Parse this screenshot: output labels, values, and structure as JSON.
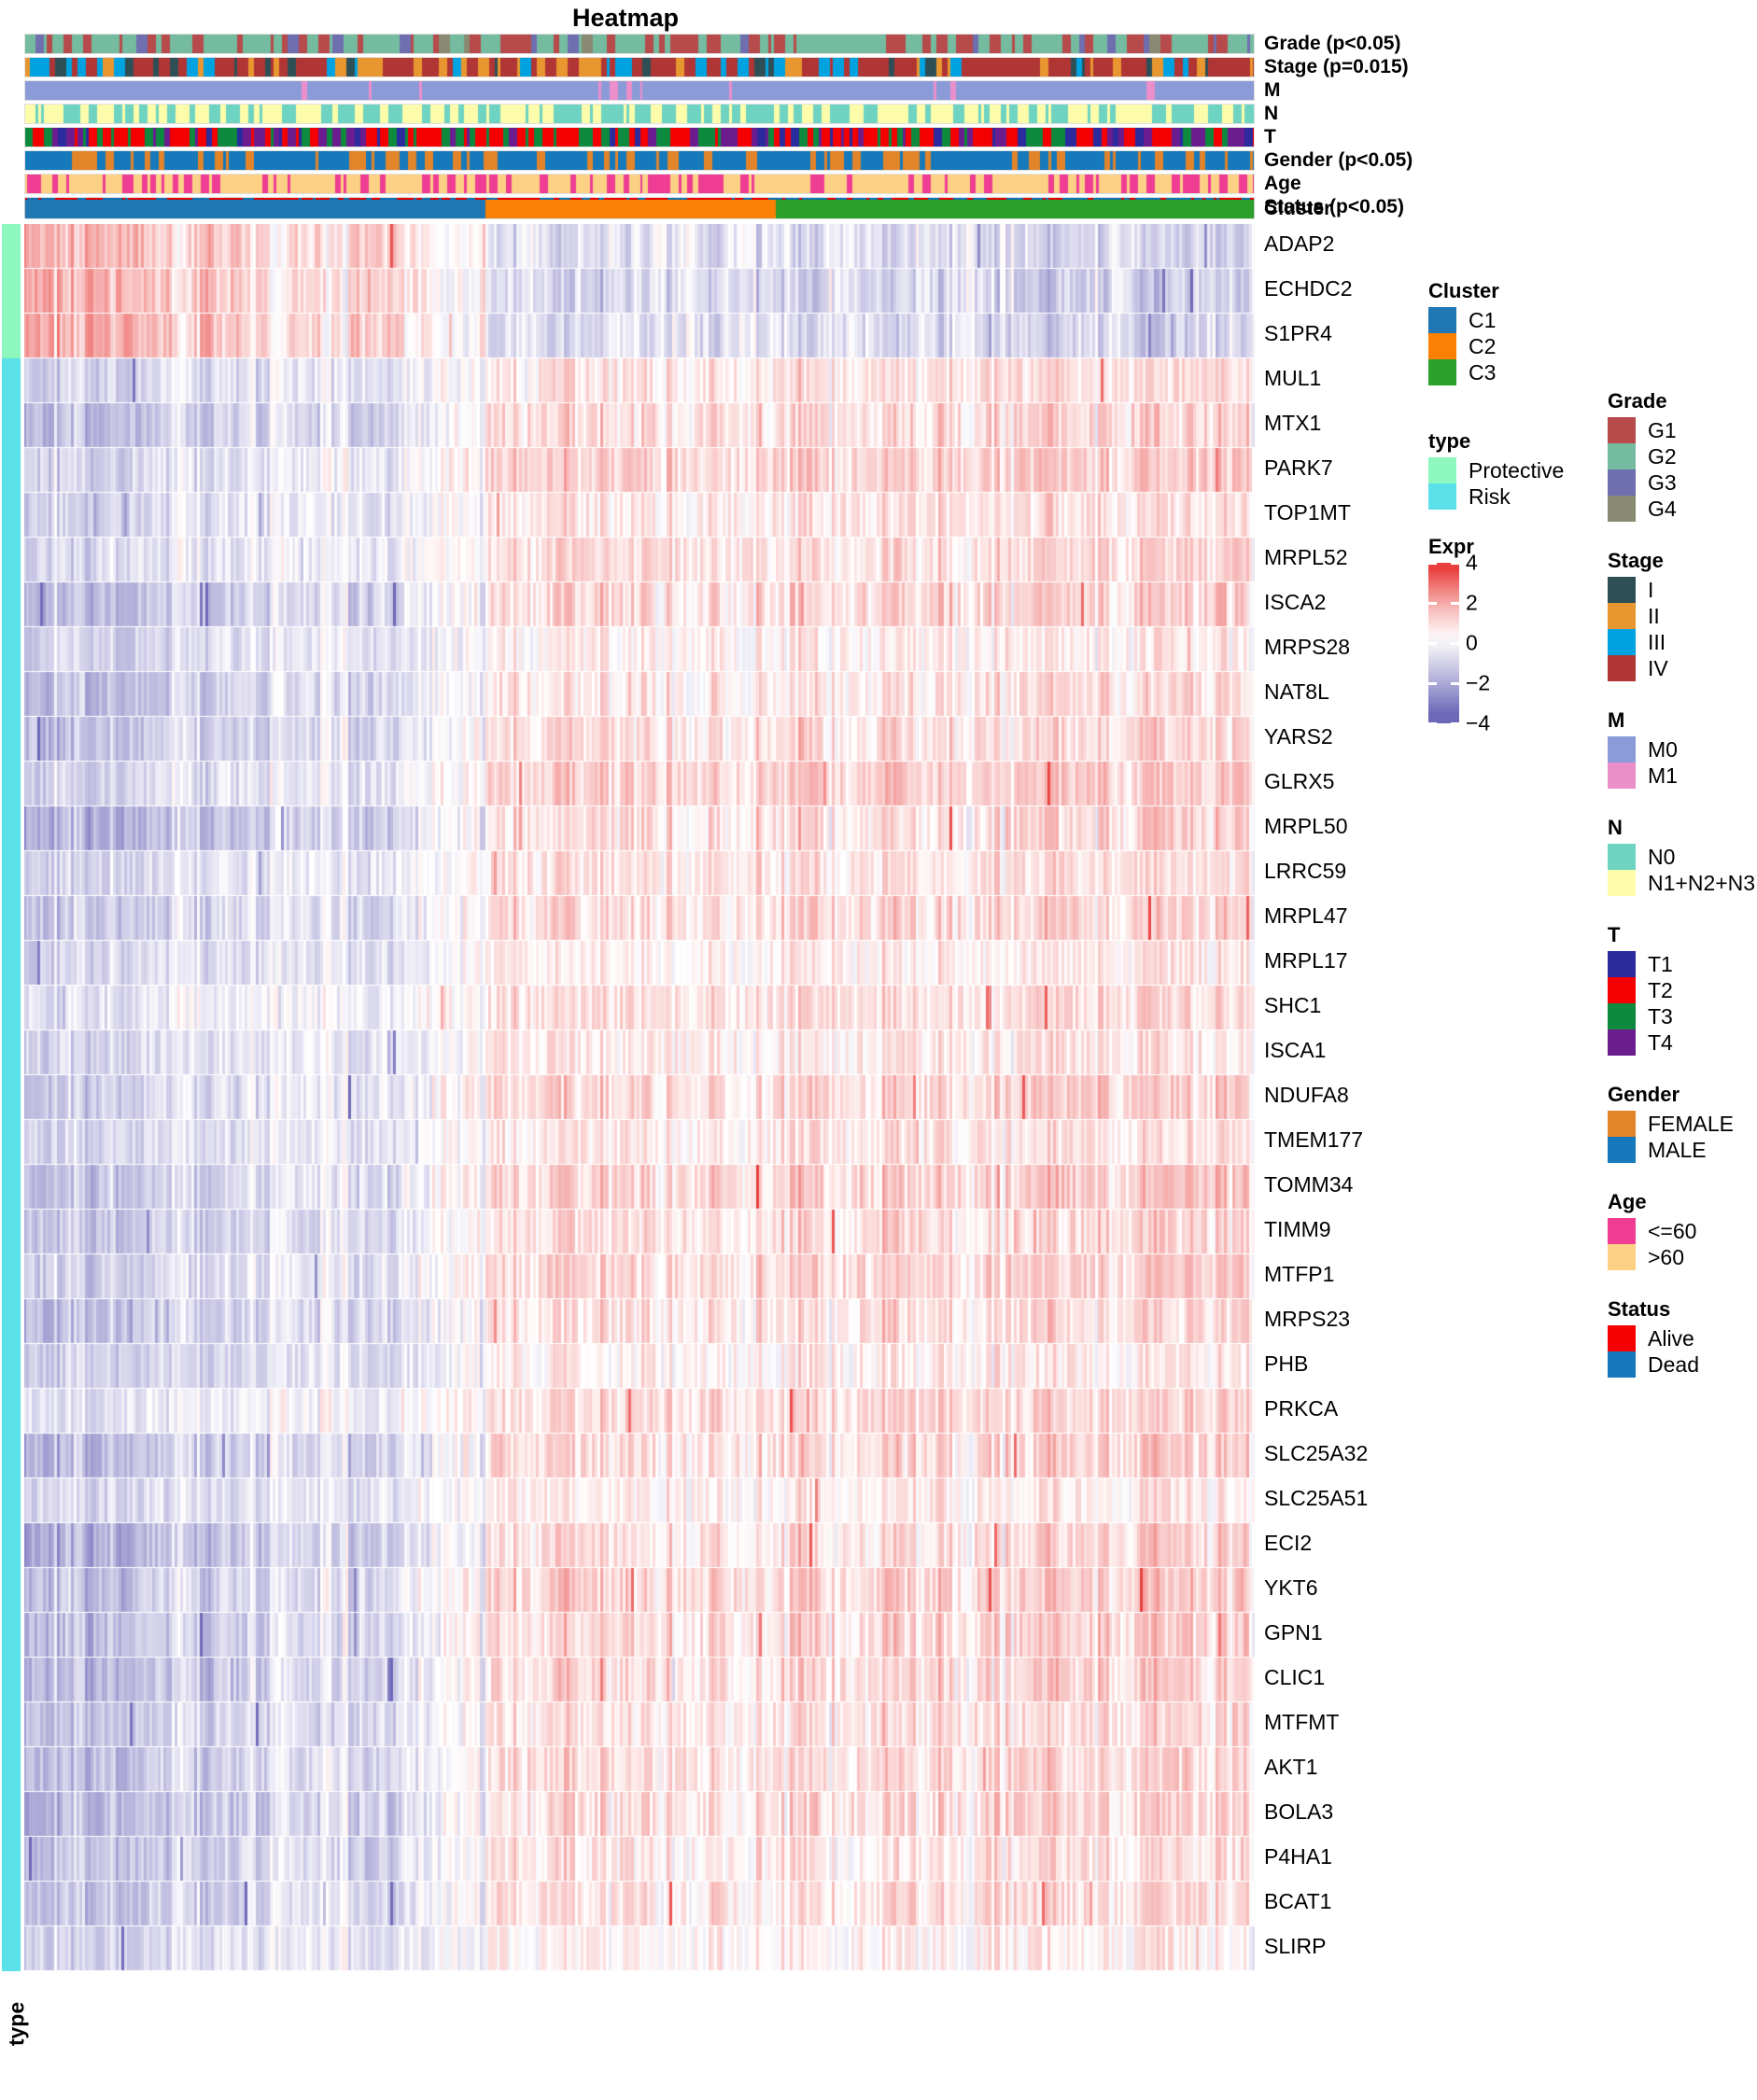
{
  "title": "Heatmap",
  "annotation_tracks": [
    {
      "id": "grade",
      "label": "Grade (p<0.05)"
    },
    {
      "id": "stage",
      "label": "Stage (p=0.015)"
    },
    {
      "id": "m",
      "label": "M"
    },
    {
      "id": "n",
      "label": "N"
    },
    {
      "id": "t",
      "label": "T"
    },
    {
      "id": "gender",
      "label": "Gender (p<0.05)"
    },
    {
      "id": "age",
      "label": "Age"
    },
    {
      "id": "status",
      "label": "Status (p<0.05)"
    },
    {
      "id": "cluster",
      "label": "Cluster"
    }
  ],
  "type_axis_label": "type",
  "genes": [
    "ADAP2",
    "ECHDC2",
    "S1PR4",
    "MUL1",
    "MTX1",
    "PARK7",
    "TOP1MT",
    "MRPL52",
    "ISCA2",
    "MRPS28",
    "NAT8L",
    "YARS2",
    "GLRX5",
    "MRPL50",
    "LRRC59",
    "MRPL47",
    "MRPL17",
    "SHC1",
    "ISCA1",
    "NDUFA8",
    "TMEM177",
    "TOMM34",
    "TIMM9",
    "MTFP1",
    "MRPS23",
    "PHB",
    "PRKCA",
    "SLC25A32",
    "SLC25A51",
    "ECI2",
    "YKT6",
    "GPN1",
    "CLIC1",
    "MTFMT",
    "AKT1",
    "BOLA3",
    "P4HA1",
    "BCAT1",
    "SLIRP"
  ],
  "gene_types": [
    "Protective",
    "Protective",
    "Protective",
    "Risk",
    "Risk",
    "Risk",
    "Risk",
    "Risk",
    "Risk",
    "Risk",
    "Risk",
    "Risk",
    "Risk",
    "Risk",
    "Risk",
    "Risk",
    "Risk",
    "Risk",
    "Risk",
    "Risk",
    "Risk",
    "Risk",
    "Risk",
    "Risk",
    "Risk",
    "Risk",
    "Risk",
    "Risk",
    "Risk",
    "Risk",
    "Risk",
    "Risk",
    "Risk",
    "Risk",
    "Risk",
    "Risk",
    "Risk",
    "Risk",
    "Risk"
  ],
  "legends": [
    {
      "id": "cluster",
      "title": "Cluster",
      "items": [
        {
          "label": "C1",
          "color": "#2077b4"
        },
        {
          "label": "C2",
          "color": "#fc8003"
        },
        {
          "label": "C3",
          "color": "#2ba02b"
        }
      ]
    },
    {
      "id": "type",
      "title": "type",
      "items": [
        {
          "label": "Protective",
          "color": "#8ef7bd"
        },
        {
          "label": "Risk",
          "color": "#59e0e8"
        }
      ]
    },
    {
      "id": "grade",
      "title": "Grade",
      "items": [
        {
          "label": "G1",
          "color": "#b74a4a"
        },
        {
          "label": "G2",
          "color": "#74bba0"
        },
        {
          "label": "G3",
          "color": "#6f6fb0"
        },
        {
          "label": "G4",
          "color": "#8a8a72"
        }
      ]
    },
    {
      "id": "stage",
      "title": "Stage",
      "items": [
        {
          "label": "I",
          "color": "#2f4f56"
        },
        {
          "label": "II",
          "color": "#e8962f"
        },
        {
          "label": "III",
          "color": "#00a3e0"
        },
        {
          "label": "IV",
          "color": "#b03535"
        }
      ]
    },
    {
      "id": "m",
      "title": "M",
      "items": [
        {
          "label": "M0",
          "color": "#8a9bd8"
        },
        {
          "label": "M1",
          "color": "#eb8fcb"
        }
      ]
    },
    {
      "id": "n",
      "title": "N",
      "items": [
        {
          "label": "N0",
          "color": "#6fd3c2"
        },
        {
          "label": "N1+N2+N3",
          "color": "#fcfcaa"
        }
      ]
    },
    {
      "id": "t",
      "title": "T",
      "items": [
        {
          "label": "T1",
          "color": "#2b2b9e"
        },
        {
          "label": "T2",
          "color": "#f40000"
        },
        {
          "label": "T3",
          "color": "#0e8a3f"
        },
        {
          "label": "T4",
          "color": "#6b1d8f"
        }
      ]
    },
    {
      "id": "gender",
      "title": "Gender",
      "items": [
        {
          "label": "FEMALE",
          "color": "#e1842a"
        },
        {
          "label": "MALE",
          "color": "#1579bb"
        }
      ]
    },
    {
      "id": "age",
      "title": "Age",
      "items": [
        {
          "label": "<=60",
          "color": "#ef3d94"
        },
        {
          "label": ">60",
          "color": "#fcd185"
        }
      ]
    },
    {
      "id": "status",
      "title": "Status",
      "items": [
        {
          "label": "Alive",
          "color": "#f40000"
        },
        {
          "label": "Dead",
          "color": "#1579bb"
        }
      ]
    }
  ],
  "expr_legend": {
    "title": "Expr",
    "ticks": [
      "4",
      "2",
      "0",
      "−2",
      "−4"
    ],
    "min": -4,
    "max": 4,
    "low_color": "#6e68b8",
    "mid_color": "#ffffff",
    "high_color": "#e8403e"
  },
  "chart_data": {
    "type": "heatmap",
    "title": "Heatmap",
    "xlabel": "",
    "ylabel": "",
    "value_label": "Expr",
    "zlim": [
      -4,
      4
    ],
    "colormap": [
      "#6e68b8",
      "#ffffff",
      "#e8403e"
    ],
    "n_samples": 440,
    "rows": [
      "ADAP2",
      "ECHDC2",
      "S1PR4",
      "MUL1",
      "MTX1",
      "PARK7",
      "TOP1MT",
      "MRPL52",
      "ISCA2",
      "MRPS28",
      "NAT8L",
      "YARS2",
      "GLRX5",
      "MRPL50",
      "LRRC59",
      "MRPL47",
      "MRPL17",
      "SHC1",
      "ISCA1",
      "NDUFA8",
      "TMEM177",
      "TOMM34",
      "TIMM9",
      "MTFP1",
      "MRPS23",
      "PHB",
      "PRKCA",
      "SLC25A32",
      "SLC25A51",
      "ECI2",
      "YKT6",
      "GPN1",
      "CLIC1",
      "MTFMT",
      "AKT1",
      "BOLA3",
      "P4HA1",
      "BCAT1",
      "SLIRP"
    ],
    "column_groups": {
      "name": "Cluster",
      "groups": [
        {
          "label": "C1",
          "color": "#2077b4",
          "fraction": 0.374
        },
        {
          "label": "C2",
          "color": "#fc8003",
          "fraction": 0.236
        },
        {
          "label": "C3",
          "color": "#2ba02b",
          "fraction": 0.39
        }
      ]
    },
    "row_groups": {
      "name": "type",
      "groups": [
        {
          "label": "Protective",
          "color": "#8ef7bd",
          "rows": 3
        },
        {
          "label": "Risk",
          "color": "#59e0e8",
          "rows": 36
        }
      ]
    },
    "annotation_tracks": [
      {
        "name": "Grade (p<0.05)",
        "categories": [
          "G1",
          "G2",
          "G3",
          "G4"
        ],
        "colors": [
          "#b74a4a",
          "#74bba0",
          "#6f6fb0",
          "#8a8a72"
        ],
        "proportions": [
          0.3,
          0.56,
          0.12,
          0.02
        ]
      },
      {
        "name": "Stage (p=0.015)",
        "categories": [
          "I",
          "II",
          "III",
          "IV"
        ],
        "colors": [
          "#2f4f56",
          "#e8962f",
          "#00a3e0",
          "#b03535"
        ],
        "proportions": [
          0.12,
          0.18,
          0.17,
          0.53
        ]
      },
      {
        "name": "M",
        "categories": [
          "M0",
          "M1"
        ],
        "colors": [
          "#8a9bd8",
          "#eb8fcb"
        ],
        "proportions": [
          0.96,
          0.04
        ]
      },
      {
        "name": "N",
        "categories": [
          "N0",
          "N1+N2+N3"
        ],
        "colors": [
          "#6fd3c2",
          "#fcfcaa"
        ],
        "proportions": [
          0.47,
          0.53
        ]
      },
      {
        "name": "T",
        "categories": [
          "T1",
          "T2",
          "T3",
          "T4"
        ],
        "colors": [
          "#2b2b9e",
          "#f40000",
          "#0e8a3f",
          "#6b1d8f"
        ],
        "proportions": [
          0.13,
          0.4,
          0.27,
          0.2
        ]
      },
      {
        "name": "Gender (p<0.05)",
        "categories": [
          "FEMALE",
          "MALE"
        ],
        "colors": [
          "#e1842a",
          "#1579bb"
        ],
        "proportions": [
          0.26,
          0.74
        ]
      },
      {
        "name": "Age",
        "categories": [
          "<=60",
          ">60"
        ],
        "colors": [
          "#ef3d94",
          "#fcd185"
        ],
        "proportions": [
          0.37,
          0.63
        ]
      },
      {
        "name": "Status (p<0.05)",
        "categories": [
          "Alive",
          "Dead"
        ],
        "colors": [
          "#f40000",
          "#1579bb"
        ],
        "proportions": [
          0.57,
          0.43
        ]
      },
      {
        "name": "Cluster",
        "categories": [
          "C1",
          "C2",
          "C3"
        ],
        "colors": [
          "#2077b4",
          "#fc8003",
          "#2ba02b"
        ],
        "proportions": [
          0.374,
          0.236,
          0.39
        ]
      }
    ],
    "row_trend_note": "Cluster C1 columns (left) are predominantly low (blue) for most risk genes while C2/C3 columns (right) trend high (red); the three protective genes (ADAP2, ECHDC2, S1PR4) show the inverse pattern."
  }
}
